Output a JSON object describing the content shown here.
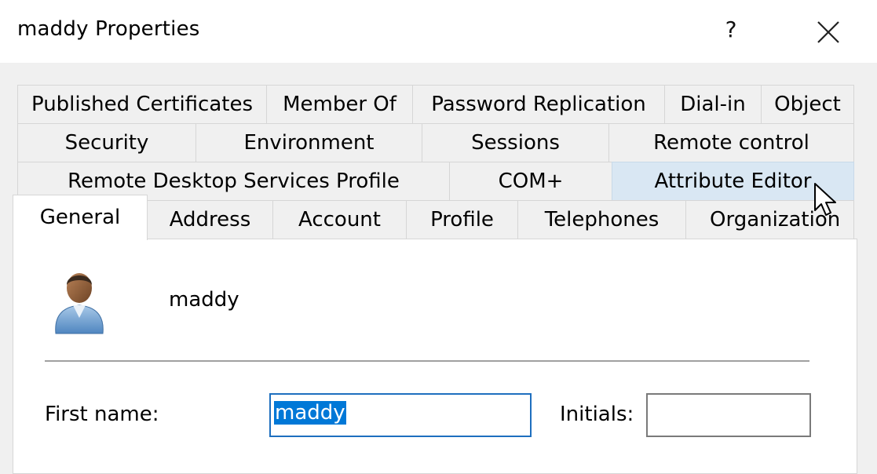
{
  "window": {
    "title": "maddy Properties",
    "help_label": "?",
    "close_icon": "close-icon"
  },
  "tabs": {
    "row1": [
      "Published Certificates",
      "Member Of",
      "Password Replication",
      "Dial-in",
      "Object"
    ],
    "row2": [
      "Security",
      "Environment",
      "Sessions",
      "Remote control"
    ],
    "row3": [
      "Remote Desktop Services Profile",
      "COM+",
      "Attribute Editor"
    ],
    "row4": [
      "General",
      "Address",
      "Account",
      "Profile",
      "Telephones",
      "Organization"
    ],
    "selected": "General",
    "hovered": "Attribute Editor"
  },
  "general": {
    "display_name": "maddy",
    "first_name_label": "First name:",
    "first_name_value": "maddy",
    "initials_label": "Initials:",
    "initials_value": ""
  },
  "colors": {
    "accent": "#0078d7",
    "hover_tab": "#d9e7f3",
    "dialog_bg": "#f0f0f0"
  }
}
